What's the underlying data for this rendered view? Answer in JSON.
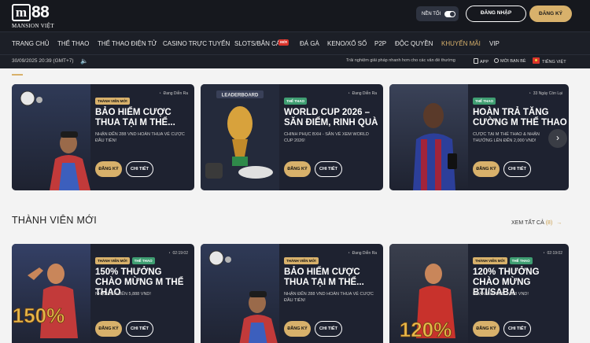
{
  "header": {
    "logo_mark": "m",
    "logo_text": "88",
    "logo_sub": "MANSION VIỆT",
    "dark_mode_label": "NỀN TỐI",
    "login_label": "ĐĂNG NHẬP",
    "register_label": "ĐĂNG KÝ"
  },
  "nav": {
    "items": [
      "TRANG CHỦ",
      "THỂ THAO",
      "THỂ THAO ĐIỆN TỬ",
      "CASINO TRỰC TUYẾN",
      "SLOTS/BẮN CÁ",
      "ĐÁ GÀ",
      "KENO/XỔ SỐ",
      "P2P",
      "ĐỘC QUYỀN",
      "KHUYẾN MÃI",
      "VIP"
    ],
    "active": "KHUYẾN MÃI",
    "new_badge": "MỚI"
  },
  "subbar": {
    "datetime": "30/09/2025 20:39 (GMT+7)",
    "marquee": "Trải nghiệm giải pháp nhanh hơn cho các vấn đề thường",
    "app_label": "APP",
    "referral_label": "MỜI BẠN BÈ",
    "language_label": "TIẾNG VIỆT"
  },
  "featured_cards": [
    {
      "status": "Đang Diễn Ra",
      "tags": [
        {
          "label": "THÀNH VIÊN MỚI",
          "color": "gold"
        }
      ],
      "title": "BẢO HIỂM CƯỢC THUA TẠI M THỂ...",
      "desc": "NHẬN ĐẾN 288 VND HOÀN THUA VÉ CƯỢC ĐẦU TIÊN!",
      "register": "ĐĂNG KÝ",
      "details": "CHI TIẾT"
    },
    {
      "status": "Đang Diễn Ra",
      "tags": [
        {
          "label": "THỂ THAO",
          "color": "green"
        }
      ],
      "title": "WORLD CUP 2026 – SĂN ĐIỂM, RINH QUÀ",
      "desc": "CHINH PHỤC BXH - SĂN VÉ XEM WORLD CUP 2026!",
      "register": "ĐĂNG KÝ",
      "details": "CHI TIẾT",
      "image_text": "LEADERBOARD"
    },
    {
      "status": "33 Ngày Còn Lại",
      "tags": [
        {
          "label": "THỂ THAO",
          "color": "green"
        }
      ],
      "title": "HOÀN TRẢ TĂNG CƯỜNG M THỂ THAO",
      "desc": "CƯỢC TẠI M THỂ THAO & NHẬN THƯỞNG LÊN ĐẾN 2,000 VND!",
      "register": "ĐĂNG KÝ",
      "details": "CHI TIẾT"
    }
  ],
  "new_member_section": {
    "title": "THÀNH VIÊN MỚI",
    "see_all": "XEM TẤT CẢ",
    "count": "(8)",
    "cards": [
      {
        "status": "02:19:02",
        "tags": [
          {
            "label": "THÀNH VIÊN MỚI",
            "color": "gold"
          },
          {
            "label": "THỂ THAO",
            "color": "green"
          }
        ],
        "title": "150% THƯỞNG CHÀO MỪNG M THỂ THAO",
        "desc": "NHẬN LÊN ĐẾN 5,888 VND!",
        "register": "ĐĂNG KÝ",
        "details": "CHI TIẾT",
        "image_text": "150%"
      },
      {
        "status": "Đang Diễn Ra",
        "tags": [
          {
            "label": "THÀNH VIÊN MỚI",
            "color": "gold"
          }
        ],
        "title": "BẢO HIỂM CƯỢC THUA TẠI M THỂ...",
        "desc": "NHẬN ĐẾN 288 VND HOÀN THUA VÉ CƯỢC ĐẦU TIÊN!",
        "register": "ĐĂNG KÝ",
        "details": "CHI TIẾT"
      },
      {
        "status": "02:19:02",
        "tags": [
          {
            "label": "THÀNH VIÊN MỚI",
            "color": "gold"
          },
          {
            "label": "THỂ THAO",
            "color": "green"
          }
        ],
        "title": "120% THƯỞNG CHÀO MỪNG BTI/SABA",
        "desc": "NHẬN LÊN ĐẾN 4,888 VND!",
        "register": "ĐĂNG KÝ",
        "details": "CHI TIẾT",
        "image_text": "120%"
      }
    ]
  },
  "colors": {
    "gold": "#d8b16b",
    "green_tag": "#3f9e72",
    "header_bg": "#16181e",
    "card_bg": "#1e2230"
  }
}
